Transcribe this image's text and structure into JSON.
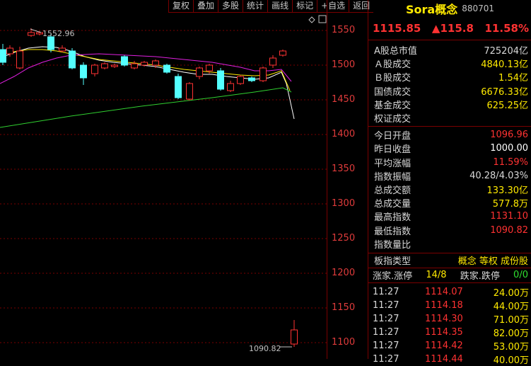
{
  "toolbar": [
    "复权",
    "叠加",
    "多股",
    "统计",
    "画线",
    "标记",
    "+自选",
    "返回"
  ],
  "chart": {
    "y_ticks": [
      "1550",
      "1500",
      "1450",
      "1400",
      "1350",
      "1300",
      "1250",
      "1200",
      "1150",
      "1100"
    ],
    "high_label": "1552.96",
    "low_label": "1090.82",
    "up_color": "#ff3232",
    "down_color": "#54ffff"
  },
  "header": {
    "name": "Sora概念",
    "code": "880701"
  },
  "quote": {
    "price": "1115.85",
    "change": "▲115.8",
    "pct": "11.58%"
  },
  "stats_a": [
    {
      "label": "A股总市值",
      "value": "725204亿",
      "color": "#d8d8d8"
    },
    {
      "label": "Ａ股成交",
      "value": "4840.13亿",
      "color": "#ffea00"
    },
    {
      "label": "Ｂ股成交",
      "value": "1.54亿",
      "color": "#ffea00"
    },
    {
      "label": "国债成交",
      "value": "6676.33亿",
      "color": "#ffea00"
    },
    {
      "label": "基金成交",
      "value": "625.25亿",
      "color": "#ffea00"
    },
    {
      "label": "权证成交",
      "value": "",
      "color": "#ffea00"
    }
  ],
  "stats_b": [
    {
      "label": "今日开盘",
      "value": "1096.96",
      "color": "#ff3232"
    },
    {
      "label": "昨日收盘",
      "value": "1000.00",
      "color": "#ffffff"
    },
    {
      "label": "平均涨幅",
      "value": "11.59%",
      "color": "#ff3232"
    },
    {
      "label": "指数振幅",
      "value": "40.28/4.03%",
      "color": "#d8d8d8"
    },
    {
      "label": "总成交额",
      "value": "133.30亿",
      "color": "#ffea00"
    },
    {
      "label": "总成交量",
      "value": "577.8万",
      "color": "#ffea00"
    },
    {
      "label": "最高指数",
      "value": "1131.10",
      "color": "#ff3232"
    },
    {
      "label": "最低指数",
      "value": "1090.82",
      "color": "#ff3232"
    },
    {
      "label": "指数量比",
      "value": "",
      "color": "#d8d8d8"
    }
  ],
  "board": {
    "label": "板指类型",
    "tags": "概念 等权 成份股"
  },
  "breadth": {
    "up_label": "涨家.涨停",
    "up_value": "14/8",
    "down_label": "跌家.跌停",
    "down_value": "0/0"
  },
  "ticks": [
    {
      "time": "11:27",
      "price": "1114.07",
      "vol": "24.00万"
    },
    {
      "time": "11:27",
      "price": "1114.18",
      "vol": "44.00万"
    },
    {
      "time": "11:27",
      "price": "1114.30",
      "vol": "71.00万"
    },
    {
      "time": "11:27",
      "price": "1114.35",
      "vol": "82.00万"
    },
    {
      "time": "11:27",
      "price": "1114.42",
      "vol": "53.00万"
    },
    {
      "time": "11:27",
      "price": "1114.44",
      "vol": "40.00万"
    }
  ]
}
